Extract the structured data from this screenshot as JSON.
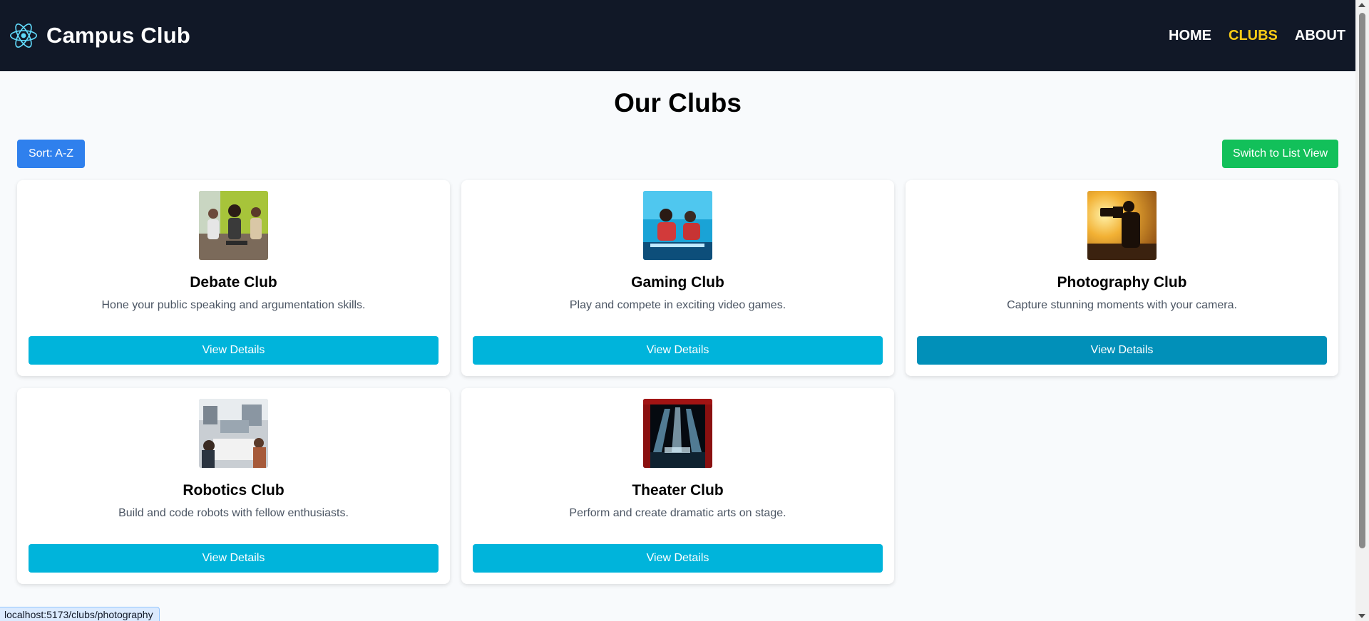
{
  "header": {
    "brand": "Campus Club",
    "logo_icon": "react-atom-icon",
    "nav": [
      {
        "label": "HOME",
        "active": false
      },
      {
        "label": "CLUBS",
        "active": true
      },
      {
        "label": "ABOUT",
        "active": false
      }
    ],
    "active_color": "#facc15"
  },
  "main": {
    "title": "Our Clubs",
    "sort_label": "Sort: A-Z",
    "switch_label": "Switch to List View",
    "clubs": [
      {
        "name": "Debate Club",
        "description": "Hone your public speaking and argumentation skills.",
        "button": "View Details",
        "image": "debate-photo"
      },
      {
        "name": "Gaming Club",
        "description": "Play and compete in exciting video games.",
        "button": "View Details",
        "image": "gaming-photo"
      },
      {
        "name": "Photography Club",
        "description": "Capture stunning moments with your camera.",
        "button": "View Details",
        "image": "photography-photo"
      },
      {
        "name": "Robotics Club",
        "description": "Build and code robots with fellow enthusiasts.",
        "button": "View Details",
        "image": "robotics-photo"
      },
      {
        "name": "Theater Club",
        "description": "Perform and create dramatic arts on stage.",
        "button": "View Details",
        "image": "theater-photo"
      }
    ]
  },
  "status_bar": {
    "url": "localhost:5173/clubs/photography"
  },
  "colors": {
    "navbar": "#111827",
    "primary_button": "#00b4db",
    "sort_button": "#2f80ed",
    "switch_button": "#12c05a"
  }
}
